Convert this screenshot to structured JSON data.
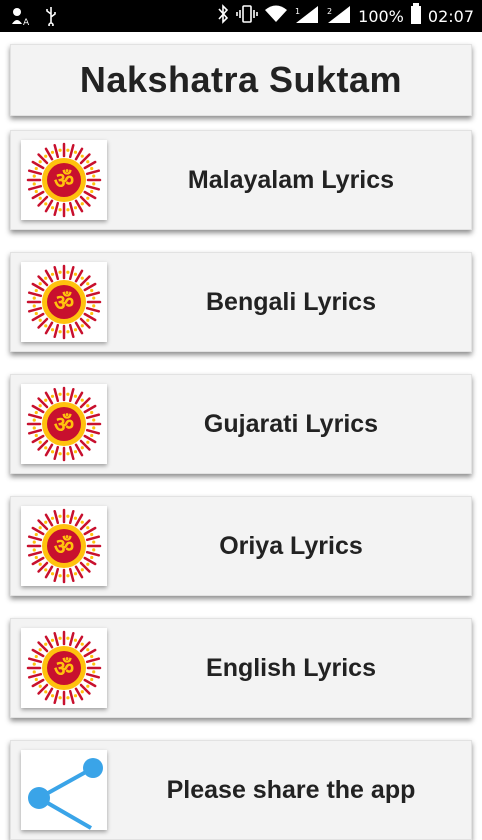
{
  "status_bar": {
    "battery_percent": "100%",
    "time": "02:07",
    "icons": [
      "missed-call-icon",
      "usb-icon",
      "bluetooth-icon",
      "vibrate-icon",
      "wifi-icon",
      "signal-icon",
      "signal-2-icon",
      "battery-icon"
    ]
  },
  "header": {
    "title": "Nakshatra Suktam"
  },
  "items": [
    {
      "label": "Malayalam Lyrics",
      "icon": "om-mandala-icon"
    },
    {
      "label": "Bengali Lyrics",
      "icon": "om-mandala-icon"
    },
    {
      "label": "Gujarati Lyrics",
      "icon": "om-mandala-icon"
    },
    {
      "label": "Oriya Lyrics",
      "icon": "om-mandala-icon"
    },
    {
      "label": "English Lyrics",
      "icon": "om-mandala-icon"
    },
    {
      "label": "Please share the app",
      "icon": "share-icon"
    }
  ],
  "colors": {
    "card_bg": "#f3f3f3",
    "om_red": "#c8102e",
    "om_yellow": "#ffc20e",
    "share_blue": "#3aa4e8"
  }
}
